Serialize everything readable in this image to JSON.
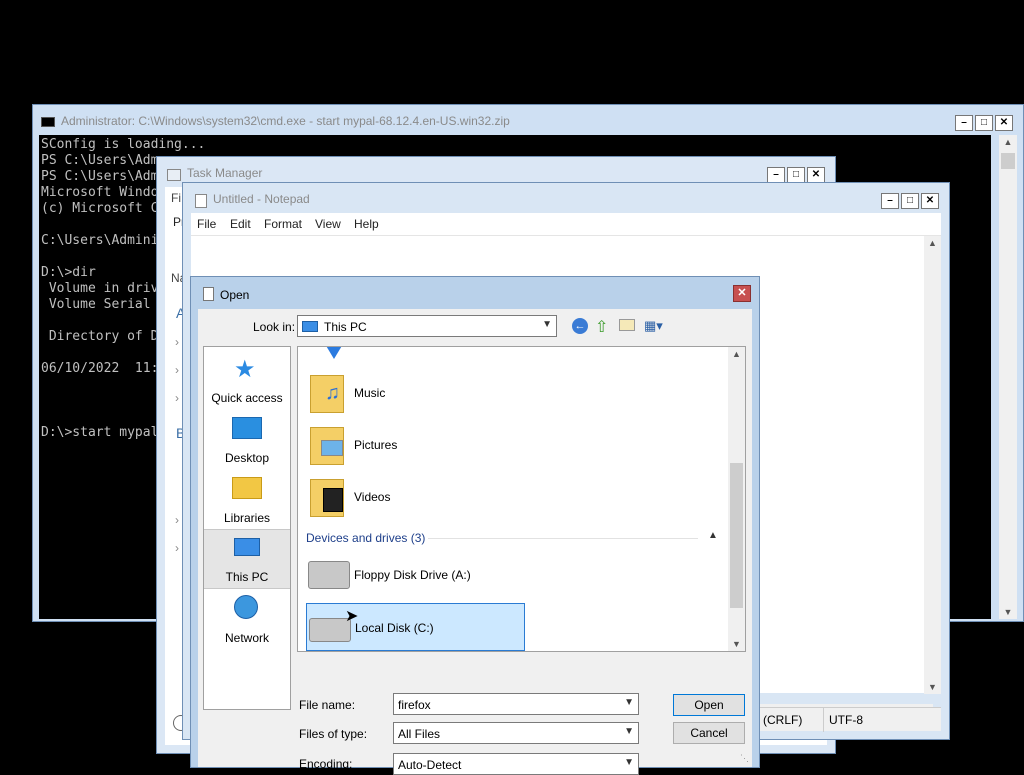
{
  "cmd": {
    "title": "Administrator: C:\\Windows\\system32\\cmd.exe - start  mypal-68.12.4.en-US.win32.zip",
    "lines": [
      "SConfig is loading...",
      "PS C:\\Users\\Adm",
      "PS C:\\Users\\Adm",
      "Microsoft Windo",
      "(c) Microsoft C",
      "",
      "C:\\Users\\Admini",
      "",
      "D:\\>dir",
      " Volume in driv",
      " Volume Serial ",
      "",
      " Directory of D",
      "",
      "06/10/2022  11:",
      "",
      "",
      "",
      "D:\\>start mypal"
    ]
  },
  "taskmgr": {
    "title": "Task Manager",
    "tab_fragment": "Pr",
    "col_fragment": "Na",
    "frag_a": "A",
    "frag_b": "B",
    "menu_fragment": "Fi"
  },
  "notepad": {
    "title": "Untitled - Notepad",
    "menu": [
      "File",
      "Edit",
      "Format",
      "View",
      "Help"
    ],
    "status_line_ending": "(CRLF)",
    "status_encoding": "UTF-8"
  },
  "dialog": {
    "title": "Open",
    "look_in_label": "Look in:",
    "look_in_value": "This PC",
    "places": [
      "Quick access",
      "Desktop",
      "Libraries",
      "This PC",
      "Network"
    ],
    "folders": [
      "Music",
      "Pictures",
      "Videos"
    ],
    "group_header": "Devices and drives (3)",
    "drives": [
      "Floppy Disk Drive (A:)",
      "Local Disk (C:)"
    ],
    "file_name_label": "File name:",
    "file_name_value": "firefox",
    "file_type_label": "Files of type:",
    "file_type_value": "All Files",
    "encoding_label": "Encoding:",
    "encoding_value": "Auto-Detect",
    "open_button": "Open",
    "cancel_button": "Cancel"
  },
  "colors": {
    "title_bar": "#cfe0f3",
    "selection": "#cce8ff",
    "selection_border": "#2a7bd3"
  }
}
